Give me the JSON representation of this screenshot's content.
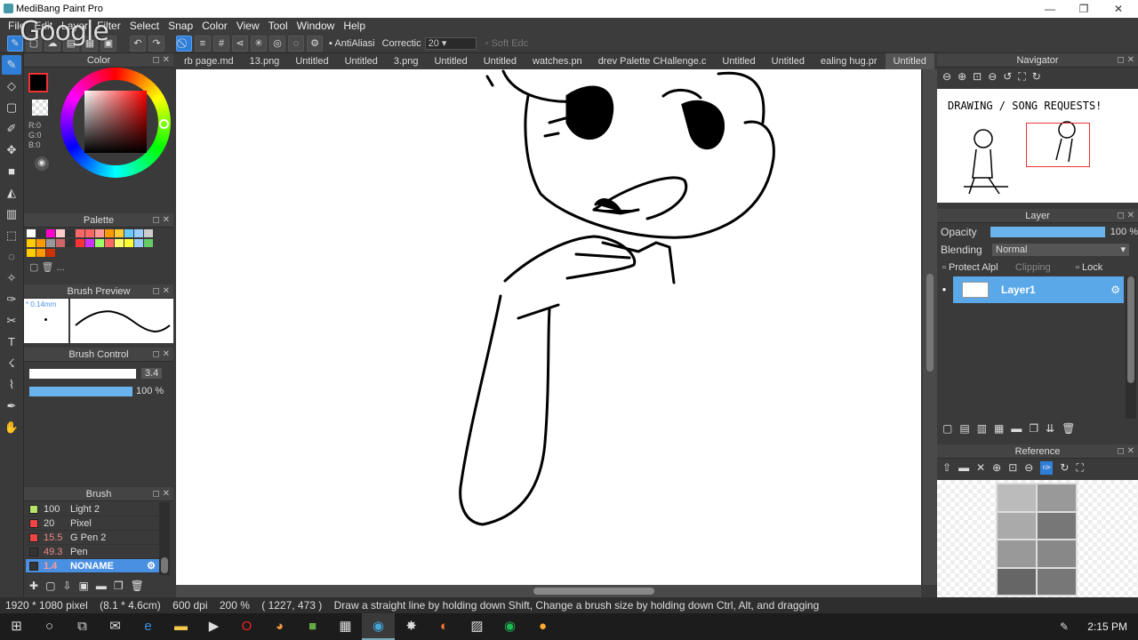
{
  "window": {
    "title": "MediBang Paint Pro"
  },
  "watermark": "Google",
  "menu": [
    "File",
    "Edit",
    "Layer",
    "Filter",
    "Select",
    "Snap",
    "Color",
    "View",
    "Tool",
    "Window",
    "Help"
  ],
  "toolbar": {
    "antialias_label": "AntiAliasi",
    "correction_label": "Correctic",
    "correction_value": "20",
    "softedge_label": "Soft Edc"
  },
  "panels": {
    "color": {
      "title": "Color",
      "r": "R:0",
      "g": "G:0",
      "b": "B:0"
    },
    "palette": {
      "title": "Palette",
      "more": "..."
    },
    "brush_preview": {
      "title": "Brush Preview",
      "size": "0.14mm"
    },
    "brush_control": {
      "title": "Brush Control",
      "size_value": "3.4",
      "opacity_value": "100 %"
    },
    "brush": {
      "title": "Brush",
      "items": [
        {
          "size": "100",
          "name": "Light 2",
          "color": "#b7e36a"
        },
        {
          "size": "20",
          "name": "Pixel",
          "color": "#e44"
        },
        {
          "size": "15.5",
          "name": "G Pen 2",
          "color": "#e44"
        },
        {
          "size": "49.3",
          "name": "Pen",
          "color": "#333"
        },
        {
          "size": "1.4",
          "name": "NONAME",
          "color": "#333"
        }
      ]
    },
    "navigator": {
      "title": "Navigator",
      "sketch_text": "DRAWING / SONG REQUESTS!"
    },
    "layer": {
      "title": "Layer",
      "opacity_label": "Opacity",
      "opacity_value": "100 %",
      "blending_label": "Blending",
      "blending_value": "Normal",
      "protect_label": "Protect Alpl",
      "clipping_label": "Clipping",
      "lock_label": "Lock",
      "layer_name": "Layer1"
    },
    "reference": {
      "title": "Reference"
    }
  },
  "tabs": [
    {
      "label": "rb page.md",
      "active": false
    },
    {
      "label": "13.png",
      "active": false
    },
    {
      "label": "Untitled",
      "active": false
    },
    {
      "label": "Untitled",
      "active": false
    },
    {
      "label": "3.png",
      "active": false
    },
    {
      "label": "Untitled",
      "active": false
    },
    {
      "label": "Untitled",
      "active": false
    },
    {
      "label": "watches.pn",
      "active": false
    },
    {
      "label": "drev Palette CHallenge.c",
      "active": false
    },
    {
      "label": "Untitled",
      "active": false
    },
    {
      "label": "Untitled",
      "active": false
    },
    {
      "label": "ealing hug.pr",
      "active": false
    },
    {
      "label": "Untitled",
      "active": true
    }
  ],
  "status": {
    "size": "1920 * 1080 pixel",
    "physical": "(8.1 * 4.6cm)",
    "dpi": "600 dpi",
    "zoom": "200 %",
    "cursor": "( 1227, 473 )",
    "hint": "Draw a straight line by holding down Shift, Change a brush size by holding down Ctrl, Alt, and dragging"
  },
  "taskbar": {
    "time": "2:15 PM"
  },
  "colors": {
    "accent": "#2f7fd8",
    "layer_selected": "#5aa8e8",
    "primary_color": "#000000"
  }
}
